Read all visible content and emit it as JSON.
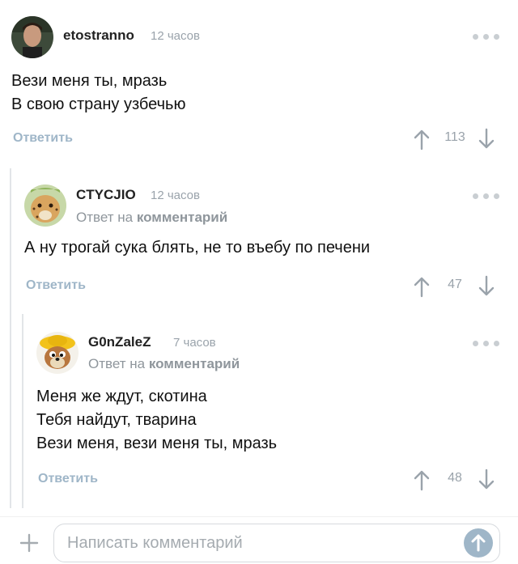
{
  "comments": [
    {
      "author": "etostranno",
      "time": "12 часов",
      "text": "Вези меня ты, мразь\nВ свою страну узбечью",
      "reply_label": "Ответить",
      "score": "113"
    },
    {
      "author": "CTYCJIO",
      "time": "12 часов",
      "reply_prefix": "Ответ на",
      "reply_link": "комментарий",
      "text": "А ну трогай сука блять, не то въебу по печени",
      "reply_label": "Ответить",
      "score": "47"
    },
    {
      "author": "G0nZaleZ",
      "time": "7 часов",
      "reply_prefix": "Ответ на",
      "reply_link": "комментарий",
      "text": "Меня же ждут, скотина\nТебя найдут, тварина\nВези меня, вези меня ты, мразь",
      "reply_label": "Ответить",
      "score": "48"
    }
  ],
  "composer": {
    "placeholder": "Написать комментарий"
  },
  "colors": {
    "accent": "#9fb6c8",
    "muted": "#9aa3ab",
    "thread_line": "#e2e5e8"
  }
}
